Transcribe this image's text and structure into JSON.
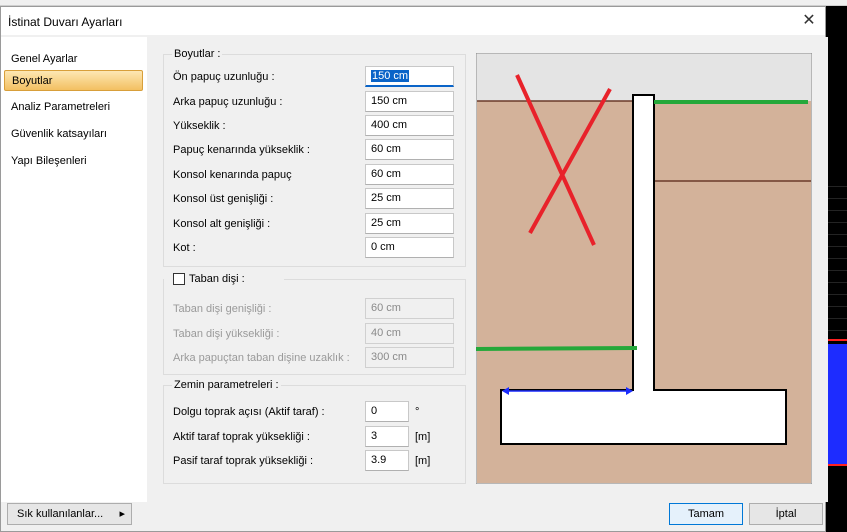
{
  "dialog": {
    "title": "İstinat Duvarı Ayarları"
  },
  "nav": {
    "items": [
      {
        "label": "Genel Ayarlar"
      },
      {
        "label": "Boyutlar"
      },
      {
        "label": "Analiz Parametreleri"
      },
      {
        "label": "Güvenlik katsayıları"
      },
      {
        "label": "Yapı Bileşenleri"
      }
    ],
    "active_index": 1
  },
  "boyutlar": {
    "title": "Boyutlar :",
    "rows": [
      {
        "label": "Ön papuç uzunluğu :",
        "value": "150 cm"
      },
      {
        "label": "Arka papuç uzunluğu :",
        "value": "150 cm"
      },
      {
        "label": "Yükseklik :",
        "value": "400 cm"
      },
      {
        "label": "Papuç kenarında yükseklik :",
        "value": "60 cm"
      },
      {
        "label": "Konsol kenarında papuç",
        "value": "60 cm"
      },
      {
        "label": "Konsol üst genişliği :",
        "value": "25 cm"
      },
      {
        "label": "Konsol alt genişliği :",
        "value": "25 cm"
      },
      {
        "label": "Kot :",
        "value": "0 cm"
      }
    ]
  },
  "taban": {
    "title": "Taban dişi :",
    "checked": false,
    "rows": [
      {
        "label": "Taban dişi genişliği :",
        "value": "60 cm"
      },
      {
        "label": "Taban dişi yüksekliği :",
        "value": "40 cm"
      },
      {
        "label": "Arka papuçtan taban dişine uzaklık :",
        "value": "300 cm"
      }
    ]
  },
  "zemin": {
    "title": "Zemin parametreleri :",
    "rows": [
      {
        "label": "Dolgu toprak açısı (Aktif taraf) :",
        "value": "0",
        "unit": "°"
      },
      {
        "label": "Aktif taraf toprak yüksekliği :",
        "value": "3",
        "unit": "[m]"
      },
      {
        "label": "Pasif taraf toprak yüksekliği :",
        "value": "3.9",
        "unit": "[m]"
      }
    ]
  },
  "buttons": {
    "favorites": "Sık kullanılanlar...",
    "favorites_arrow": "▸",
    "ok": "Tamam",
    "cancel": "İptal"
  },
  "icons": {
    "close": "close-icon",
    "checkbox": "checkbox-icon",
    "chevron": "chevron-right-icon"
  },
  "colors": {
    "soil": "#d3b29a",
    "sky": "#e4e4e4",
    "ground_line": "#6b3a2a",
    "green_marker": "#25a83a",
    "red_cross": "#e8222a",
    "blue_dim": "#1a2cff",
    "accent": "#0a64c8"
  }
}
